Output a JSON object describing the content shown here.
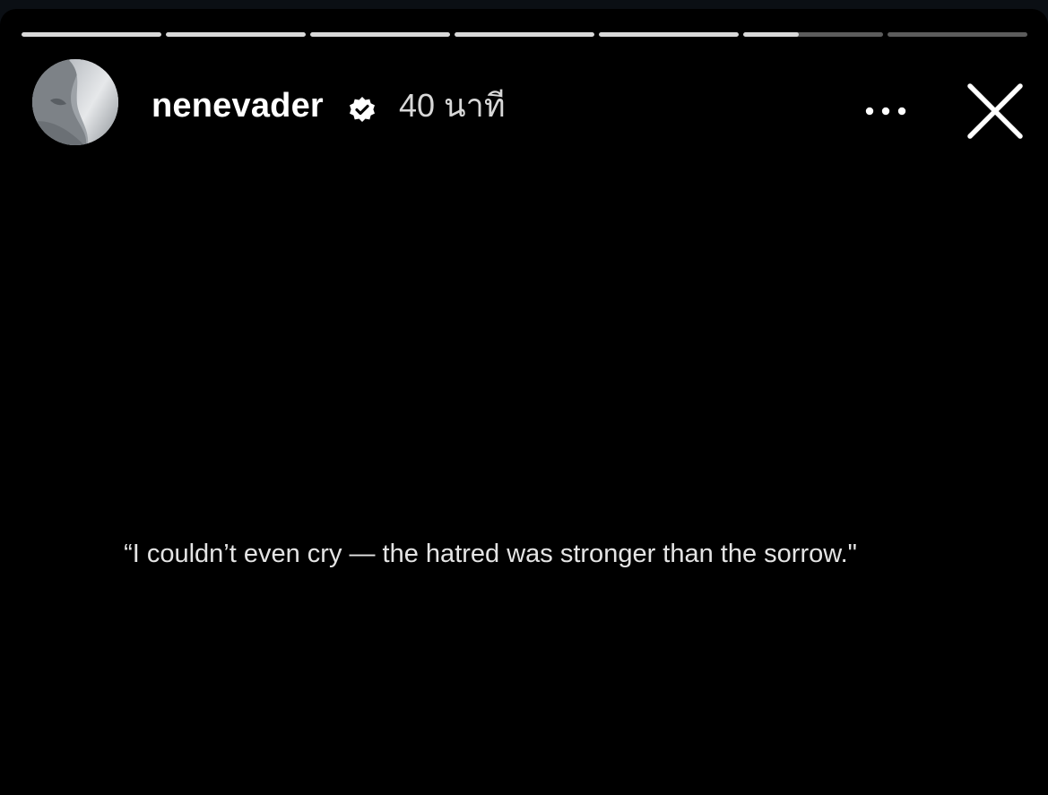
{
  "story": {
    "segment_count": 7,
    "current_segment": 6,
    "current_segment_progress": 0.4,
    "colors": {
      "background": "#000000",
      "progress_track": "#5c5c5c",
      "progress_fill": "#d9d9d9",
      "text_primary": "#ffffff",
      "text_secondary": "#d8d8d8"
    }
  },
  "header": {
    "avatar_icon": "avatar-icon",
    "username": "nenevader",
    "verified_icon": "verified-badge-icon",
    "timestamp": "40 นาที",
    "more_icon": "more-options-icon",
    "close_icon": "close-icon"
  },
  "content": {
    "quote": "“I couldn’t even cry — the hatred was stronger than the sorrow.\""
  }
}
